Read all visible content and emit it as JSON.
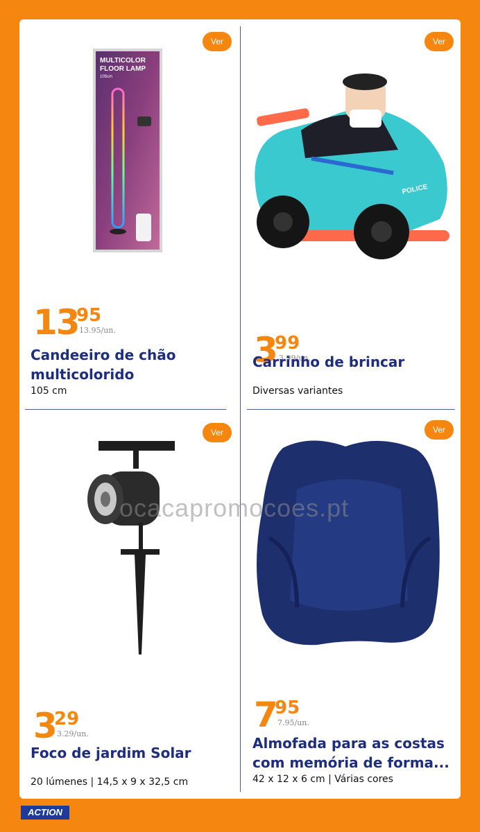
{
  "products": [
    {
      "ver_label": "Ver",
      "price_int": "13",
      "price_dec": "95",
      "unit_price": "13.95/un.",
      "title_line1": "Candeeiro de chão",
      "title_line2": "multicolorido",
      "subtitle": "105 cm",
      "image_box_text1": "MULTICOLOR",
      "image_box_text2": "FLOOR LAMP",
      "image_box_text3": "105cm"
    },
    {
      "ver_label": "Ver",
      "price_int": "3",
      "price_dec": "99",
      "unit_price": "3.99/un.",
      "title_line1": "Carrinho de brincar",
      "subtitle": "Diversas variantes",
      "image_car_text": "POLICE"
    },
    {
      "ver_label": "Ver",
      "price_int": "3",
      "price_dec": "29",
      "unit_price": "3.29/un.",
      "title_line1": "Foco de jardim Solar",
      "subtitle": "20 lúmenes | 14,5 x 9 x 32,5 cm"
    },
    {
      "ver_label": "Ver",
      "price_int": "7",
      "price_dec": "95",
      "unit_price": "7.95/un.",
      "title_line1": "Almofada para as costas",
      "title_line2": "com memória de forma...",
      "subtitle": "42 x 12 x 6 cm | Várias cores"
    }
  ],
  "watermark": "ocacapromocoes.pt",
  "brand": "ACTION",
  "colors": {
    "accent": "#f5860f",
    "title": "#1e2d7d",
    "background": "#f5860f"
  }
}
